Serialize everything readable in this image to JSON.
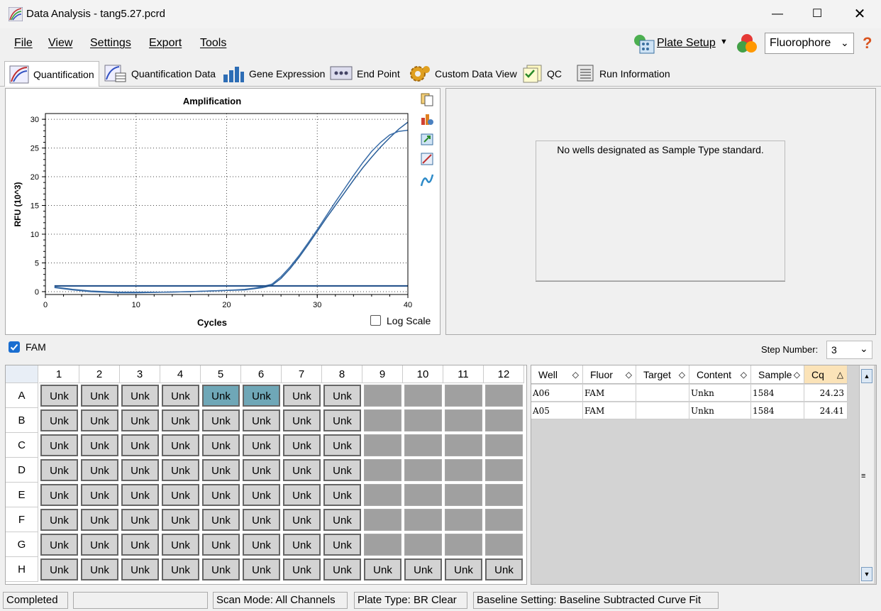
{
  "window": {
    "title": "Data Analysis - tang5.27.pcrd"
  },
  "menu": {
    "file": "File",
    "view": "View",
    "settings": "Settings",
    "export": "Export",
    "tools": "Tools"
  },
  "toolbar": {
    "plate_setup": "Plate Setup",
    "fluorophore": "Fluorophore",
    "help": "?"
  },
  "tabs": [
    {
      "label": "Quantification"
    },
    {
      "label": "Quantification Data"
    },
    {
      "label": "Gene Expression"
    },
    {
      "label": "End Point"
    },
    {
      "label": "Custom Data View"
    },
    {
      "label": "QC"
    },
    {
      "label": "Run Information"
    }
  ],
  "chart_data": {
    "type": "line",
    "title": "Amplification",
    "xlabel": "Cycles",
    "ylabel": "RFU (10^3)",
    "xlim": [
      0,
      40
    ],
    "ylim": [
      -0.5,
      31
    ],
    "xticks": [
      0,
      10,
      20,
      30,
      40
    ],
    "yticks": [
      0,
      5,
      10,
      15,
      20,
      25,
      30
    ],
    "grid": true,
    "series": [
      {
        "x": [
          1,
          3,
          5,
          8,
          10,
          13,
          16,
          18,
          20,
          22,
          23,
          24,
          25,
          26,
          27,
          28,
          29,
          30,
          31,
          32,
          33,
          34,
          35,
          36,
          37,
          38,
          39,
          40
        ],
        "y": [
          0.8,
          0.4,
          0.1,
          -0.1,
          -0.1,
          -0.1,
          0,
          0.1,
          0.2,
          0.3,
          0.5,
          0.7,
          1.1,
          2.3,
          4.0,
          6.0,
          8.2,
          10.5,
          12.8,
          15.0,
          17.2,
          19.4,
          21.5,
          23.4,
          25.2,
          26.8,
          28.3,
          29.5
        ]
      },
      {
        "x": [
          1,
          3,
          5,
          8,
          10,
          13,
          16,
          18,
          20,
          22,
          23,
          24,
          25,
          26,
          27,
          28,
          29,
          30,
          31,
          32,
          33,
          34,
          35,
          36,
          37,
          38,
          39,
          40
        ],
        "y": [
          0.7,
          0.3,
          0,
          -0.2,
          -0.2,
          -0.1,
          0,
          0.1,
          0.2,
          0.4,
          0.6,
          0.9,
          1.3,
          2.6,
          4.3,
          6.3,
          8.5,
          10.8,
          13.2,
          15.6,
          17.9,
          20.2,
          22.4,
          24.4,
          26.0,
          27.3,
          27.9,
          28.1
        ]
      },
      {
        "x": [
          1,
          40
        ],
        "y": [
          1.0,
          1.0
        ]
      }
    ],
    "log_scale_label": "Log Scale"
  },
  "right_panel": {
    "message": "No wells designated as Sample Type standard."
  },
  "fluor_filter": {
    "label": "FAM",
    "checked": true
  },
  "step": {
    "label": "Step Number:",
    "value": "3"
  },
  "plate": {
    "columns": [
      "1",
      "2",
      "3",
      "4",
      "5",
      "6",
      "7",
      "8",
      "9",
      "10",
      "11",
      "12"
    ],
    "rows": [
      "A",
      "B",
      "C",
      "D",
      "E",
      "F",
      "G",
      "H"
    ],
    "well_label": "Unk",
    "selected": [
      "A5",
      "A6"
    ]
  },
  "table": {
    "headers": [
      "Well",
      "Fluor",
      "Target",
      "Content",
      "Sample",
      "Cq"
    ],
    "rows": [
      [
        "A06",
        "FAM",
        "",
        "Unkn",
        "1584",
        "24.23"
      ],
      [
        "A05",
        "FAM",
        "",
        "Unkn",
        "1584",
        "24.41"
      ]
    ]
  },
  "status": {
    "state": "Completed",
    "scan_mode": "Scan Mode: All Channels",
    "plate_type": "Plate Type: BR Clear",
    "baseline": "Baseline Setting: Baseline Subtracted Curve Fit"
  }
}
